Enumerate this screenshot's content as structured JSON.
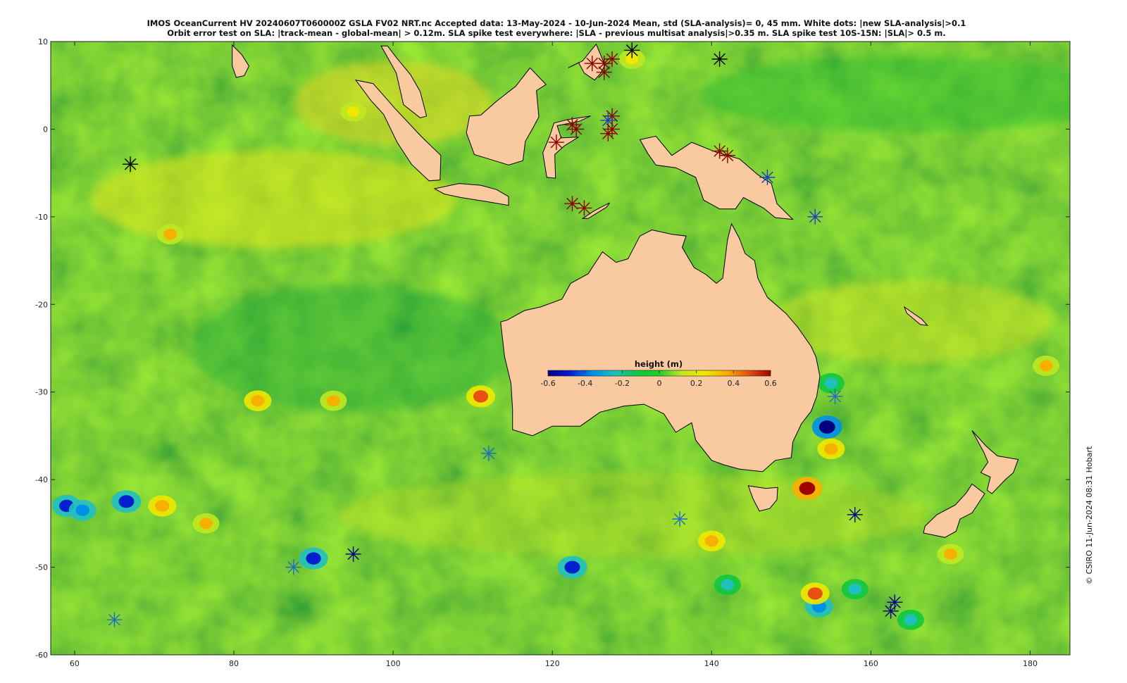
{
  "header": {
    "title_line1": "IMOS OceanCurrent HV 20240607T060000Z GSLA FV02 NRT.nc  Accepted data: 13-May-2024 - 10-Jun-2024 Mean, std (SLA-analysis)= 0, 45 mm. White dots: |new SLA-analysis|>0.1",
    "title_line2": "Orbit error test on SLA: |track-mean  - global-mean| > 0.12m.  SLA spike test everywhere: |SLA - previous multisat analysis|>0.35 m. SLA spike test 10S-15N: |SLA|> 0.5 m."
  },
  "credit": "© CSIRO 11-Jun-2024 08:31 Hobart",
  "colors": {
    "land": "#f9c9a0",
    "ocean_mid": "#22c02a",
    "coast": "#000000"
  },
  "icons": {
    "spike_marker": "asterisk-icon"
  },
  "chart_data": {
    "type": "heatmap",
    "variable": "sea level anomaly",
    "xlim": [
      57,
      185
    ],
    "ylim": [
      -60,
      10
    ],
    "xticks": [
      60,
      80,
      100,
      120,
      140,
      160,
      180
    ],
    "yticks": [
      10,
      0,
      -10,
      -20,
      -30,
      -40,
      -50,
      -60
    ],
    "colorbar": {
      "title": "height (m)",
      "range": [
        -0.6,
        0.6
      ],
      "ticks": [
        "-0.6",
        "-0.4",
        "-0.2",
        "0",
        "0.2",
        "0.4",
        "0.6"
      ],
      "colors": [
        "#00007f",
        "#0020d0",
        "#0090e8",
        "#20c0c0",
        "#10c840",
        "#20d020",
        "#c0e820",
        "#f0e800",
        "#f8b000",
        "#e85010",
        "#a00000"
      ]
    },
    "eddies": [
      {
        "lon": 154.5,
        "lat": -34.0,
        "value": -0.55
      },
      {
        "lon": 152.0,
        "lat": -41.0,
        "value": 0.55
      },
      {
        "lon": 155.0,
        "lat": -36.5,
        "value": 0.35
      },
      {
        "lon": 66.5,
        "lat": -42.5,
        "value": -0.5
      },
      {
        "lon": 59.0,
        "lat": -43.0,
        "value": -0.45
      },
      {
        "lon": 61.0,
        "lat": -43.5,
        "value": -0.35
      },
      {
        "lon": 71.0,
        "lat": -43.0,
        "value": 0.4
      },
      {
        "lon": 90.0,
        "lat": -49.0,
        "value": -0.45
      },
      {
        "lon": 122.5,
        "lat": -50.0,
        "value": -0.5
      },
      {
        "lon": 111.0,
        "lat": -30.5,
        "value": 0.45
      },
      {
        "lon": 153.5,
        "lat": -54.5,
        "value": -0.4
      },
      {
        "lon": 153.0,
        "lat": -53.0,
        "value": 0.45
      },
      {
        "lon": 158.0,
        "lat": -52.5,
        "value": -0.3
      },
      {
        "lon": 155.0,
        "lat": -29.0,
        "value": -0.3
      },
      {
        "lon": 83.0,
        "lat": -31.0,
        "value": 0.35
      },
      {
        "lon": 92.5,
        "lat": -31.0,
        "value": 0.3
      },
      {
        "lon": 76.5,
        "lat": -45.0,
        "value": 0.3
      },
      {
        "lon": 140.0,
        "lat": -47.0,
        "value": 0.35
      },
      {
        "lon": 170.0,
        "lat": -48.5,
        "value": 0.3
      },
      {
        "lon": 142.0,
        "lat": -52.0,
        "value": -0.3
      },
      {
        "lon": 165.0,
        "lat": -56.0,
        "value": -0.3
      },
      {
        "lon": 72.0,
        "lat": -12.0,
        "value": 0.3
      },
      {
        "lon": 95.0,
        "lat": 2.0,
        "value": 0.25
      },
      {
        "lon": 130.0,
        "lat": 8.0,
        "value": 0.25
      },
      {
        "lon": 182.0,
        "lat": -27.0,
        "value": 0.3
      }
    ],
    "spike_markers": [
      {
        "lon": 67.0,
        "lat": -4.0,
        "color": "#000000"
      },
      {
        "lon": 130.0,
        "lat": 9.0,
        "color": "#000000"
      },
      {
        "lon": 141.0,
        "lat": 8.0,
        "color": "#000000"
      },
      {
        "lon": 126.5,
        "lat": 7.5,
        "color": "#8b0000"
      },
      {
        "lon": 127.5,
        "lat": 8.0,
        "color": "#8b0000"
      },
      {
        "lon": 126.5,
        "lat": 6.5,
        "color": "#8b0000"
      },
      {
        "lon": 125.0,
        "lat": 7.5,
        "color": "#8b0000"
      },
      {
        "lon": 127.5,
        "lat": 1.5,
        "color": "#8b0000"
      },
      {
        "lon": 127.0,
        "lat": 1.0,
        "color": "#1f3fbf"
      },
      {
        "lon": 127.0,
        "lat": -0.5,
        "color": "#8b0000"
      },
      {
        "lon": 127.5,
        "lat": 0.0,
        "color": "#8b0000"
      },
      {
        "lon": 122.5,
        "lat": 0.5,
        "color": "#8b0000"
      },
      {
        "lon": 123.0,
        "lat": 0.0,
        "color": "#8b0000"
      },
      {
        "lon": 120.5,
        "lat": -1.5,
        "color": "#8b0000"
      },
      {
        "lon": 122.5,
        "lat": -8.5,
        "color": "#8b0000"
      },
      {
        "lon": 124.0,
        "lat": -9.0,
        "color": "#8b0000"
      },
      {
        "lon": 141.0,
        "lat": -2.5,
        "color": "#8b0000"
      },
      {
        "lon": 142.0,
        "lat": -3.0,
        "color": "#8b0000"
      },
      {
        "lon": 147.0,
        "lat": -5.5,
        "color": "#1f3fbf"
      },
      {
        "lon": 153.0,
        "lat": -10.0,
        "color": "#1f3fbf"
      },
      {
        "lon": 155.5,
        "lat": -30.5,
        "color": "#1f6fbf"
      },
      {
        "lon": 112.0,
        "lat": -37.0,
        "color": "#1f6fbf"
      },
      {
        "lon": 136.0,
        "lat": -44.5,
        "color": "#1f6fbf"
      },
      {
        "lon": 158.0,
        "lat": -44.0,
        "color": "#000080"
      },
      {
        "lon": 95.0,
        "lat": -48.5,
        "color": "#000080"
      },
      {
        "lon": 87.5,
        "lat": -50.0,
        "color": "#1f6fbf"
      },
      {
        "lon": 65.0,
        "lat": -56.0,
        "color": "#1f6fbf"
      },
      {
        "lon": 163.0,
        "lat": -54.0,
        "color": "#000080"
      },
      {
        "lon": 162.5,
        "lat": -55.0,
        "color": "#000080"
      }
    ]
  }
}
